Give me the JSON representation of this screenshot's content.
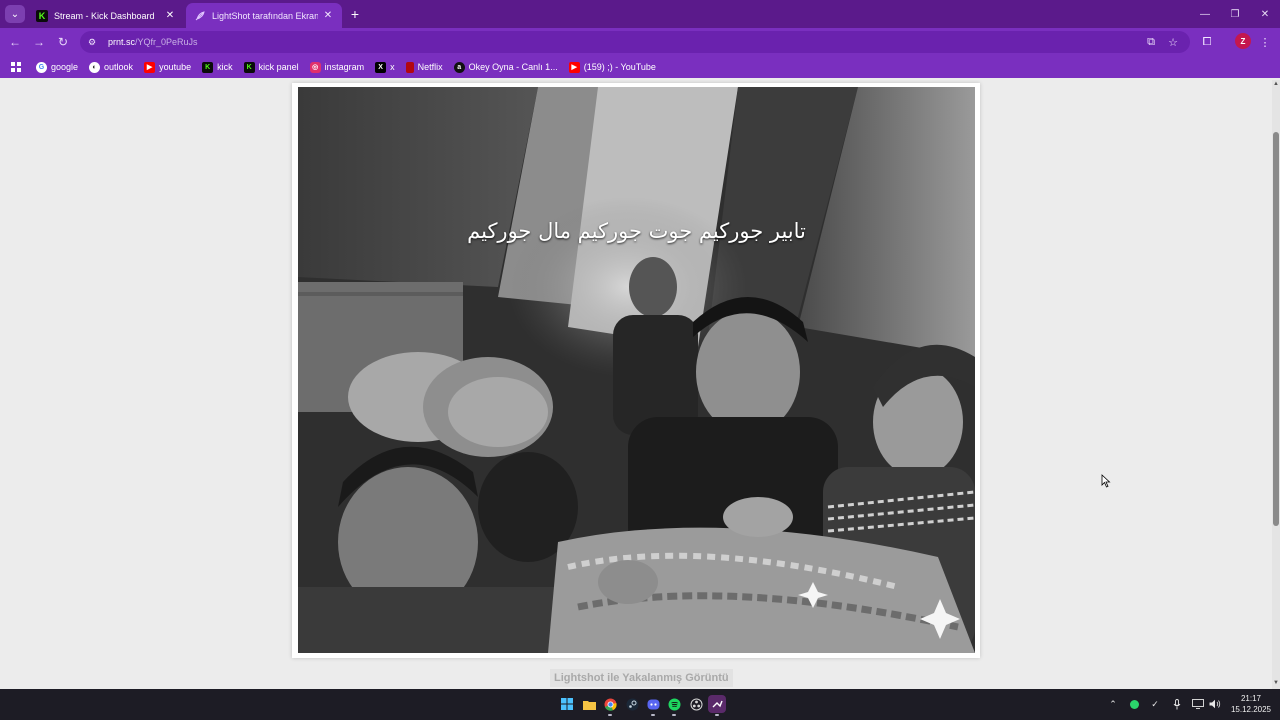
{
  "browser": {
    "tabs": [
      {
        "title": "Stream - Kick Dashboard",
        "favicon": "kick-icon",
        "active": false
      },
      {
        "title": "LightShot tarafından Ekran Görüntüsü",
        "favicon": "lightshot-feather-icon",
        "active": true
      }
    ],
    "address": {
      "host": "prnt.sc",
      "path": "/YQfr_0PeRuJs"
    },
    "profile_initial": "Z",
    "accent_color": "#7a2fbf",
    "frame_color": "#5b1a8b"
  },
  "bookmarks": [
    {
      "label": "google",
      "icon": "google-icon"
    },
    {
      "label": "outlook",
      "icon": "outlook-icon"
    },
    {
      "label": "youtube",
      "icon": "youtube-icon"
    },
    {
      "label": "kick",
      "icon": "kick-icon"
    },
    {
      "label": "kick panel",
      "icon": "kick-icon"
    },
    {
      "label": "instagram",
      "icon": "instagram-icon"
    },
    {
      "label": "x",
      "icon": "x-icon"
    },
    {
      "label": "Netflix",
      "icon": "netflix-icon"
    },
    {
      "label": "Okey Oyna - Canlı 1...",
      "icon": "okey-icon"
    },
    {
      "label": "(159) ;) - YouTube",
      "icon": "youtube-icon"
    }
  ],
  "page": {
    "image_caption": "تابير جوركيم جوت جوركيم مال جوركيم",
    "footer_text": "Lightshot ile Yakalanmış Görüntü"
  },
  "taskbar": {
    "apps": [
      "windows-start-icon",
      "file-explorer-icon",
      "chrome-icon",
      "steam-icon",
      "discord-icon",
      "spotify-icon",
      "obs-icon",
      "kick-studio-icon"
    ],
    "time": "21:17",
    "date": "15.12.2025"
  }
}
